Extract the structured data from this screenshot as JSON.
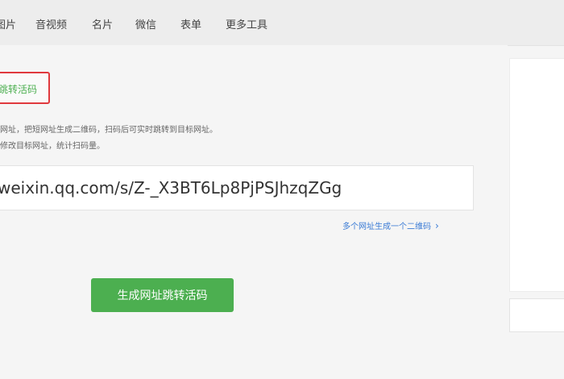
{
  "nav": {
    "items": [
      "图片",
      "音视频",
      "名片",
      "微信",
      "表单",
      "更多工具"
    ]
  },
  "main": {
    "active_mode_label": "跳转活码",
    "description_lines": [
      "网址，把短网址生成二维码，扫码后可实时跳转到目标网址。",
      "修改目标网址，统计扫码量。"
    ],
    "url_value": "weixin.qq.com/s/Z-_X3BT6Lp8PjPSJhzqZGg",
    "multi_link_label": "多个网址生成一个二维码",
    "generate_button_label": "生成网址跳转活码"
  },
  "colors": {
    "accent_green": "#4caf50",
    "highlight_red": "#e0393e",
    "link_blue": "#3a7bd5"
  },
  "icons": {
    "multi_link_chevron": "chevron-right-icon"
  }
}
